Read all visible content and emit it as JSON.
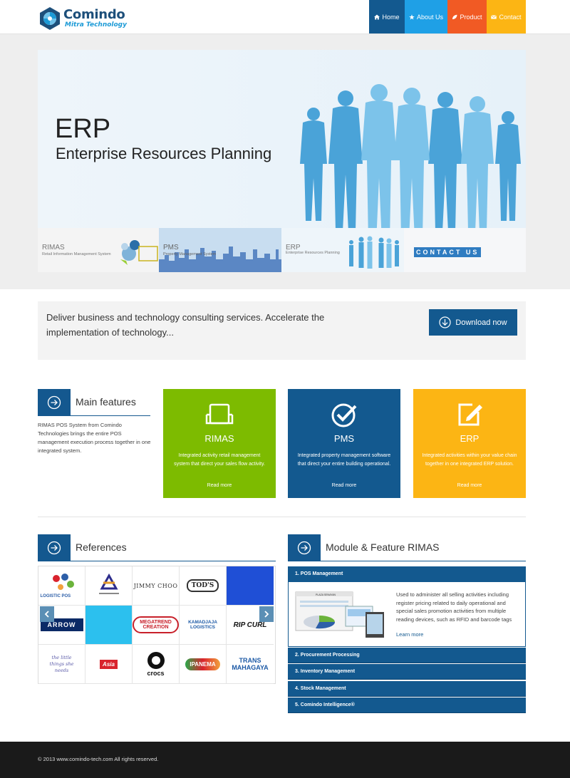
{
  "header": {
    "brand": "Comindo",
    "tagline": "Mitra Technology",
    "nav": [
      {
        "label": "Home",
        "color": "#13598f"
      },
      {
        "label": "About Us",
        "color": "#1fa0e6"
      },
      {
        "label": "Product",
        "color": "#f15a24"
      },
      {
        "label": "Contact",
        "color": "#fcb514"
      }
    ]
  },
  "hero": {
    "title": "ERP",
    "subtitle": "Enterprise Resources Planning",
    "thumbs": [
      {
        "title": "RIMAS",
        "subtitle": "Retail Information Management System"
      },
      {
        "title": "PMS",
        "subtitle": "Property Management System"
      },
      {
        "title": "ERP",
        "subtitle": "Enterprise Resources Planning"
      },
      {
        "title": "CONTACT US",
        "subtitle": ""
      }
    ]
  },
  "cta": {
    "text": "Deliver business and technology consulting services. Accelerate the implementation of technology...",
    "button": "Download now"
  },
  "features": {
    "heading": "Main features",
    "description": "RIMAS POS System from Comindo Technologies brings the entire POS management execution process together in one integrated system.",
    "cards": [
      {
        "title": "RIMAS",
        "desc": "Integrated activity retail management system that direct your sales flow activity.",
        "link": "Read more",
        "color": "#7dbb00",
        "icon": "tablet-icon"
      },
      {
        "title": "PMS",
        "desc": "Integrated property management software that direct your entire building operational.",
        "link": "Read more",
        "color": "#13598f",
        "icon": "check-circle-icon"
      },
      {
        "title": "ERP",
        "desc": "Integrated activities within your value chain together in one integrated ERP solution.",
        "link": "Read more",
        "color": "#fcb514",
        "icon": "edit-icon"
      }
    ]
  },
  "references": {
    "heading": "References",
    "logos": [
      "LOGISTIC POS",
      "",
      "JIMMY CHOO",
      "TOD'S",
      "",
      "ARROW",
      "",
      "MEGATREND CREATION",
      "KAMADJAJA LOGISTICS",
      "RIP CURL",
      "the little things she needs",
      "Asia",
      "crocs",
      "IPANEMA",
      "TRANS MAHAGAYA"
    ]
  },
  "modules": {
    "heading": "Module & Feature RIMAS",
    "items": [
      "1. POS Management",
      "2. Procurement Processing",
      "3. Inventory Management",
      "4. Stock Management",
      "5. Comindo Intelligence®"
    ],
    "active_text": "Used to administer all selling activities including register pricing related to daily operational and special sales promotion activities from multiple reading devices, such as RFID and barcode tags",
    "learn_more": "Learn more",
    "screen_label": "PLAZA SENAYAN"
  },
  "footer": {
    "copyright": "© 2013 www.comindo-tech.com All rights reserved."
  }
}
